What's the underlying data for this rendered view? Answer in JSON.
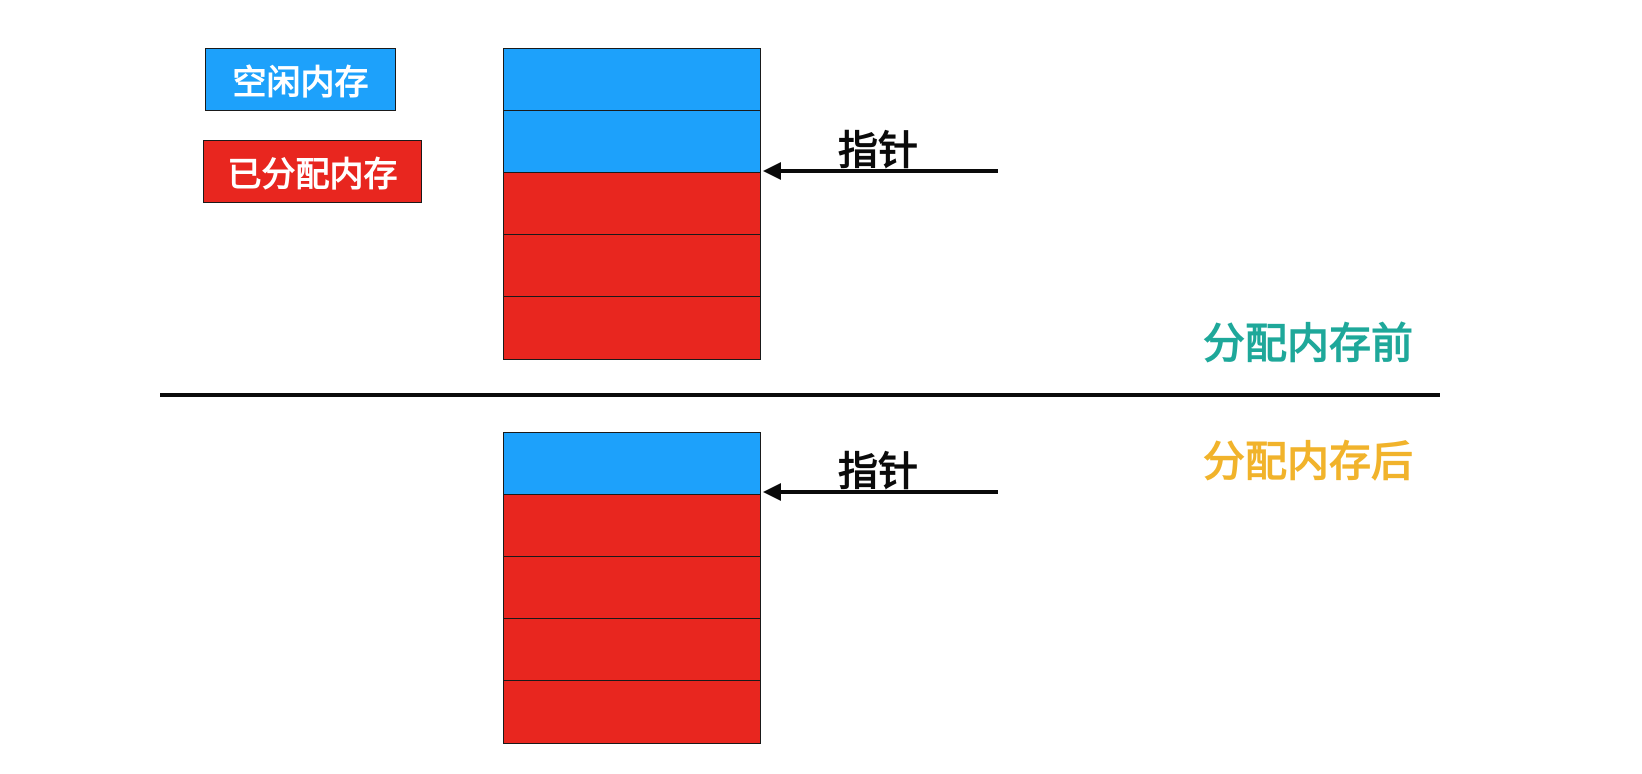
{
  "legend": {
    "free_label": "空闲内存",
    "allocated_label": "已分配内存"
  },
  "colors": {
    "free": "#1da1fb",
    "allocated": "#e8261f",
    "before_label": "#1ea89a",
    "after_label": "#f1b32b"
  },
  "before": {
    "label": "分配内存前",
    "pointer_label": "指针",
    "blocks": [
      "free",
      "free",
      "allocated",
      "allocated",
      "allocated"
    ]
  },
  "after": {
    "label": "分配内存后",
    "pointer_label": "指针",
    "blocks": [
      "free",
      "allocated",
      "allocated",
      "allocated",
      "allocated"
    ]
  }
}
